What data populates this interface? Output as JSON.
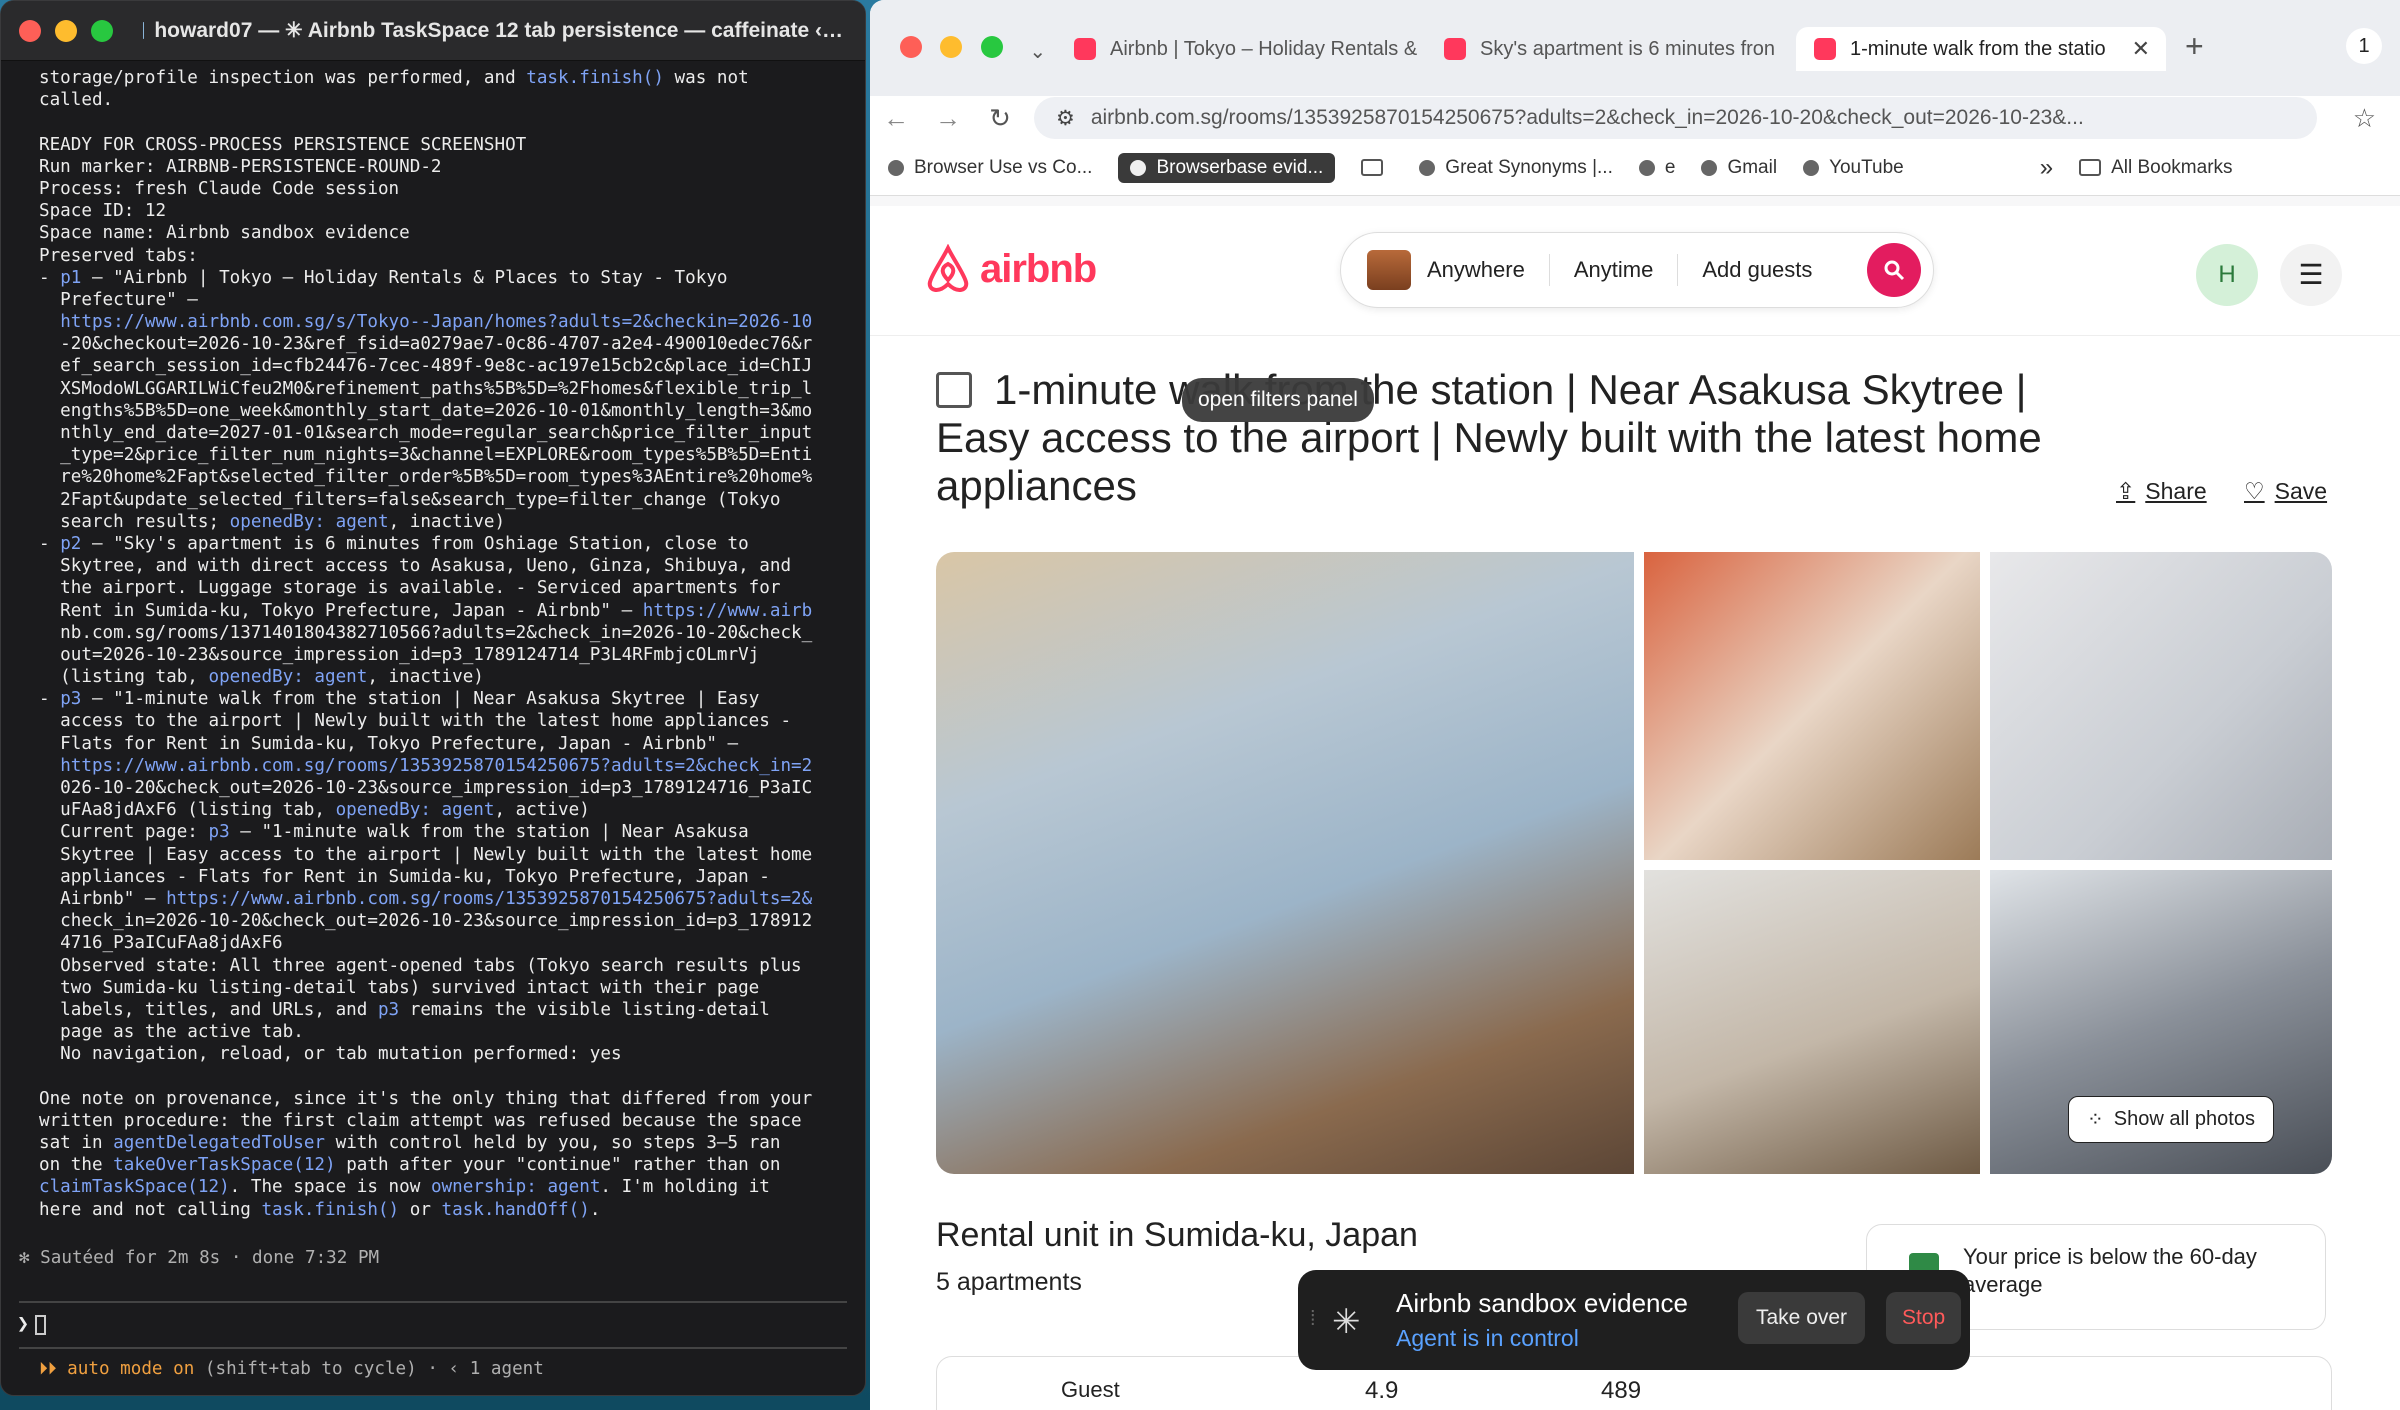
{
  "terminal": {
    "title": "howard07 — ✳ Airbnb TaskSpace 12 tab persistence — caffeinate ‹…",
    "lines": [
      "storage/profile inspection was performed, and task.finish() was not",
      "called.",
      "",
      "READY FOR CROSS-PROCESS PERSISTENCE SCREENSHOT",
      "Run marker: AIRBNB-PERSISTENCE-ROUND-2",
      "Process: fresh Claude Code session",
      "Space ID: 12",
      "Space name: Airbnb sandbox evidence",
      "Preserved tabs:",
      "- p1 — \"Airbnb | Tokyo — Holiday Rentals & Places to Stay - Tokyo",
      "  Prefecture\" —",
      "  https://www.airbnb.com.sg/s/Tokyo--Japan/homes?adults=2&checkin=2026-10",
      "  -20&checkout=2026-10-23&ref_fsid=a0279ae7-0c86-4707-a2e4-490010edec76&r",
      "  ef_search_session_id=cfb24476-7cec-489f-9e8c-ac197e15cb2c&place_id=ChIJ",
      "  XSModoWLGGARILWiCfeu2M0&refinement_paths%5B%5D=%2Fhomes&flexible_trip_l",
      "  engths%5B%5D=one_week&monthly_start_date=2026-10-01&monthly_length=3&mo",
      "  nthly_end_date=2027-01-01&search_mode=regular_search&price_filter_input",
      "  _type=2&price_filter_num_nights=3&channel=EXPLORE&room_types%5B%5D=Enti",
      "  re%20home%2Fapt&selected_filter_order%5B%5D=room_types%3AEntire%20home%",
      "  2Fapt&update_selected_filters=false&search_type=filter_change (Tokyo",
      "  search results; openedBy: agent, inactive)",
      "- p2 — \"Sky's apartment is 6 minutes from Oshiage Station, close to",
      "  Skytree, and with direct access to Asakusa, Ueno, Ginza, Shibuya, and",
      "  the airport. Luggage storage is available. - Serviced apartments for",
      "  Rent in Sumida-ku, Tokyo Prefecture, Japan - Airbnb\" — https://www.airb",
      "  nb.com.sg/rooms/1371401804382710566?adults=2&check_in=2026-10-20&check_",
      "  out=2026-10-23&source_impression_id=p3_1789124714_P3L4RFmbjcOLmrVj",
      "  (listing tab, openedBy: agent, inactive)",
      "- p3 — \"1-minute walk from the station | Near Asakusa Skytree | Easy",
      "  access to the airport | Newly built with the latest home appliances -",
      "  Flats for Rent in Sumida-ku, Tokyo Prefecture, Japan - Airbnb\" —",
      "  https://www.airbnb.com.sg/rooms/1353925870154250675?adults=2&check_in=2",
      "  026-10-20&check_out=2026-10-23&source_impression_id=p3_1789124716_P3aIC",
      "  uFAa8jdAxF6 (listing tab, openedBy: agent, active)",
      "  Current page: p3 — \"1-minute walk from the station | Near Asakusa",
      "  Skytree | Easy access to the airport | Newly built with the latest home",
      "  appliances - Flats for Rent in Sumida-ku, Tokyo Prefecture, Japan -",
      "  Airbnb\" — https://www.airbnb.com.sg/rooms/1353925870154250675?adults=2&",
      "  check_in=2026-10-20&check_out=2026-10-23&source_impression_id=p3_178912",
      "  4716_P3aICuFAa8jdAxF6",
      "  Observed state: All three agent-opened tabs (Tokyo search results plus",
      "  two Sumida-ku listing-detail tabs) survived intact with their page",
      "  labels, titles, and URLs, and p3 remains the visible listing-detail",
      "  page as the active tab.",
      "  No navigation, reload, or tab mutation performed: yes",
      "",
      "One note on provenance, since it's the only thing that differed from your",
      "written procedure: the first claim attempt was refused because the space",
      "sat in agentDelegatedToUser with control held by you, so steps 3–5 ran",
      "on the takeOverTaskSpace(12) path after your \"continue\" rather than on",
      "claimTaskSpace(12). The space is now ownership: agent. I'm holding it",
      "here and not calling task.finish() or task.handOff()."
    ],
    "status": "✻ Sautéed for 2m 8s · done 7:32 PM",
    "prompt": "❯",
    "mode_prefix": "⏵⏵ auto mode on",
    "mode_suffix": " (shift+tab to cycle) · ‹ 1 agent"
  },
  "browser": {
    "tabs": [
      {
        "label": "Airbnb | Tokyo – Holiday Rentals &",
        "active": false
      },
      {
        "label": "Sky's apartment is 6 minutes fron",
        "active": false
      },
      {
        "label": "1-minute walk from the statio",
        "active": true
      }
    ],
    "new_tab": "+",
    "profile_badge": "1",
    "url": "airbnb.com.sg/rooms/1353925870154250675?adults=2&check_in=2026-10-20&check_out=2026-10-23&...",
    "bookmarks": [
      "Browser Use vs Co...",
      "Browserbase evid...",
      "Great Synonyms |...",
      "e",
      "Gmail",
      "YouTube"
    ],
    "bookmarks_more": "»",
    "all_bookmarks": "All Bookmarks"
  },
  "airbnb": {
    "logo": "airbnb",
    "search": {
      "anywhere": "Anywhere",
      "anytime": "Anytime",
      "guests": "Add guests"
    },
    "avatar": "H",
    "title": "1-minute walk from the station | Near Asakusa Skytree | Easy access to the airport | Newly built with the latest home appliances",
    "tooltip": "open filters panel",
    "share": "Share",
    "save": "Save",
    "show_photos": "Show all photos",
    "rental_type": "Rental unit in Sumida-ku, Japan",
    "rental_count": "5 apartments",
    "price_note": "Your price is below the 60-day average",
    "bottom_text_1": "Guest",
    "bottom_rating": "4.9",
    "bottom_reviews": "489"
  },
  "agent_bar": {
    "space": "Airbnb sandbox evidence",
    "status": "Agent is in control",
    "takeover": "Take over",
    "stop": "Stop"
  },
  "colors": {
    "brand": "#ff385c",
    "agent_status": "#5aa2ff",
    "stop": "#ff5a5a"
  }
}
